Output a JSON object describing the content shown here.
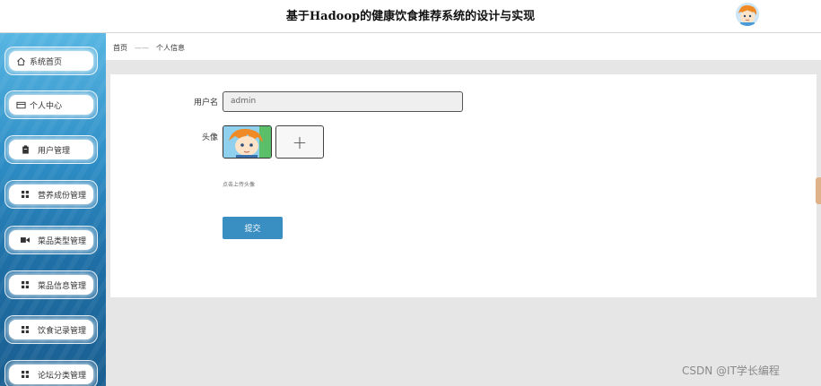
{
  "header": {
    "title": "基于Hadoop的健康饮食推荐系统的设计与实现"
  },
  "sidebar": {
    "items": [
      {
        "label": "系统首页",
        "icon": "home-icon"
      },
      {
        "label": "个人中心",
        "icon": "card-icon"
      },
      {
        "label": "用户管理",
        "icon": "clipboard-icon"
      },
      {
        "label": "营养成份管理",
        "icon": "grid-icon"
      },
      {
        "label": "菜品类型管理",
        "icon": "video-icon"
      },
      {
        "label": "菜品信息管理",
        "icon": "grid-icon"
      },
      {
        "label": "饮食记录管理",
        "icon": "grid-icon"
      },
      {
        "label": "论坛分类管理",
        "icon": "grid-icon"
      }
    ]
  },
  "breadcrumb": {
    "home": "首页",
    "separator": "——",
    "current": "个人信息"
  },
  "form": {
    "username_label": "用户名",
    "username_value": "admin",
    "avatar_label": "头像",
    "upload_plus": "+",
    "upload_hint": "点击上传头像",
    "submit_label": "提交"
  },
  "watermark": "CSDN @IT学长编程",
  "colors": {
    "accent": "#3a8fc2",
    "sidebar_top": "#58b6e2",
    "sidebar_bottom": "#1a5f91",
    "content_bg": "#e6e6e6"
  }
}
